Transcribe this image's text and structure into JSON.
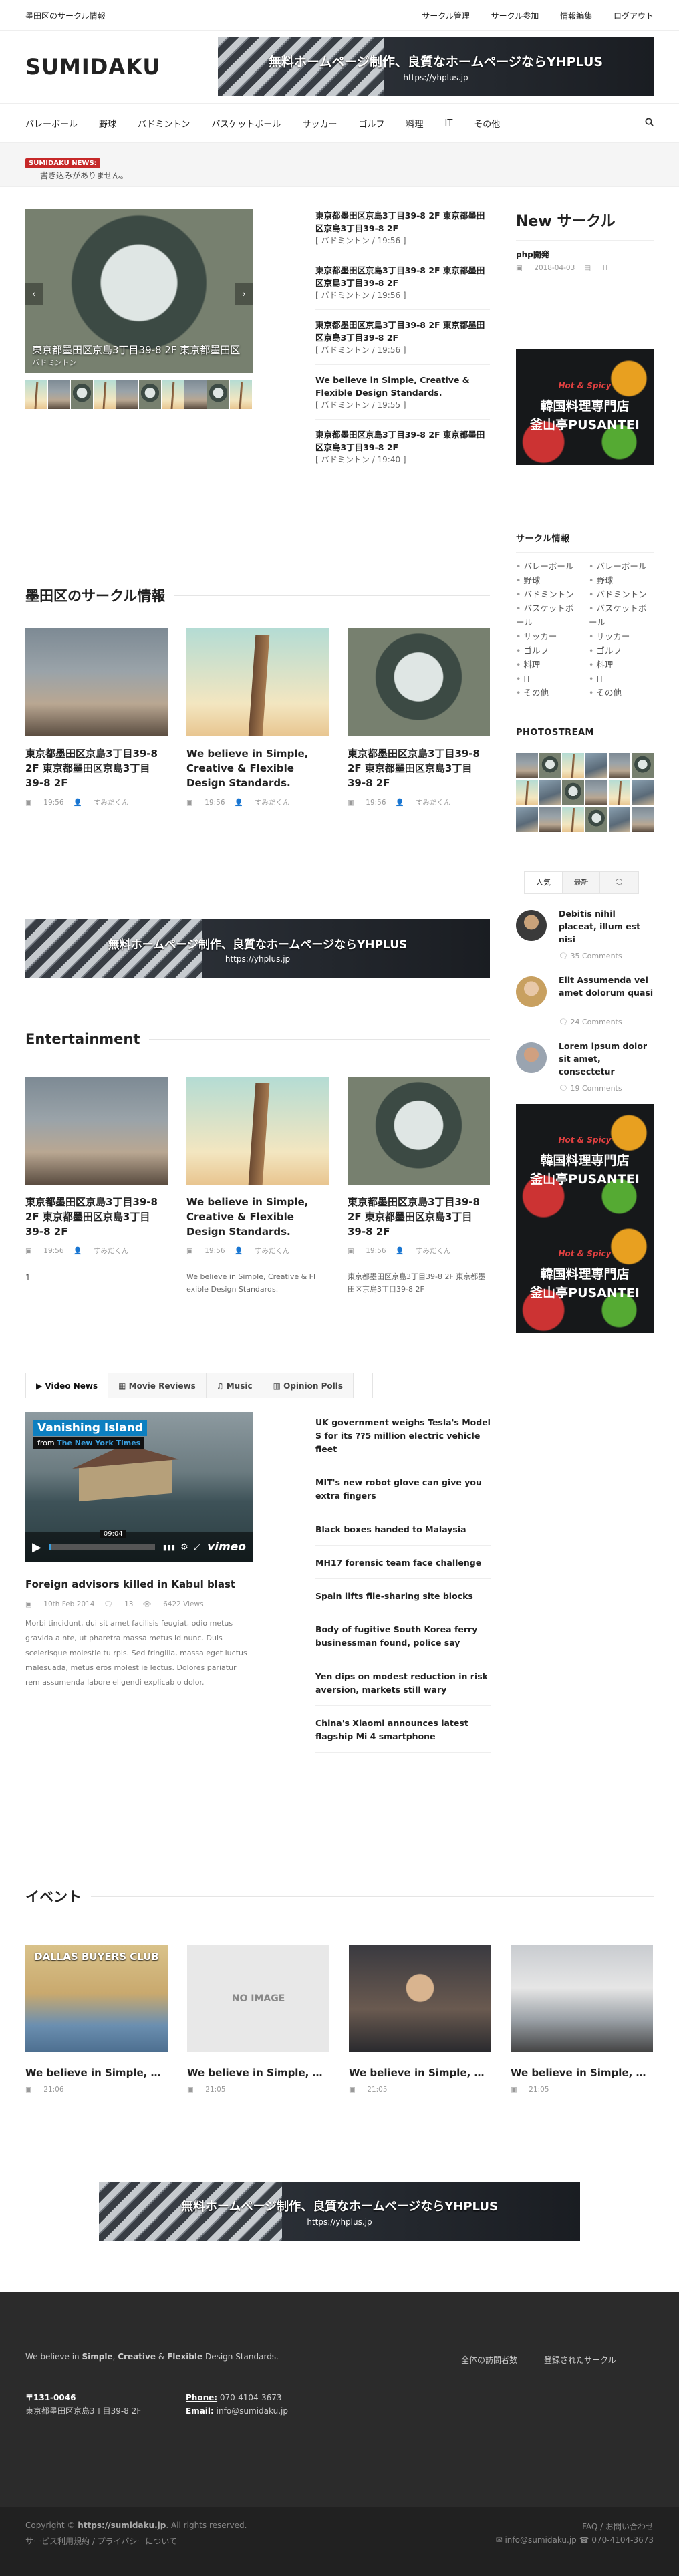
{
  "topbar": {
    "site_name": "墨田区のサークル情報",
    "links": [
      "サークル管理",
      "サークル参加",
      "情報編集",
      "ログアウト"
    ]
  },
  "header": {
    "logo": "SUMIDAKU",
    "banner_text": "無料ホームページ制作、良質なホームページならYHPLUS",
    "banner_url": "https://yhplus.jp"
  },
  "nav": {
    "items": [
      "バレーボール",
      "野球",
      "バドミントン",
      "バスケットボール",
      "サッカー",
      "ゴルフ",
      "料理",
      "IT",
      "その他"
    ],
    "search_icon": "search-icon"
  },
  "news": {
    "tag": "SUMIDAKU NEWS:",
    "message": "書き込みがありません。"
  },
  "slider": {
    "caption": "東京都墨田区京島3丁目39-8 2F 東京都墨田区",
    "category": "バドミントン"
  },
  "featured_list": [
    {
      "title": "東京都墨田区京島3丁目39-8 2F 東京都墨田区京島3丁目39-8 2F",
      "meta": "[ バドミントン / 19:56 ]"
    },
    {
      "title": "東京都墨田区京島3丁目39-8 2F 東京都墨田区京島3丁目39-8 2F",
      "meta": "[ バドミントン / 19:56 ]"
    },
    {
      "title": "東京都墨田区京島3丁目39-8 2F 東京都墨田区京島3丁目39-8 2F",
      "meta": "[ バドミントン / 19:56 ]"
    },
    {
      "title": "We believe in Simple, Creative & Flexible Design Standards.",
      "meta": "[ バドミントン / 19:55 ]"
    },
    {
      "title": "東京都墨田区京島3丁目39-8 2F 東京都墨田区京島3丁目39-8 2F",
      "meta": "[ バドミントン / 19:40 ]"
    }
  ],
  "circle_section": {
    "title": "墨田区のサークル情報",
    "cards": [
      {
        "title": "東京都墨田区京島3丁目39-8 2F 東京都墨田区京島3丁目39-8 2F",
        "time": "19:56",
        "author": "すみだくん"
      },
      {
        "title": "We believe in Simple, Creative & Flexible Design Standards.",
        "time": "19:56",
        "author": "すみだくん"
      },
      {
        "title": "東京都墨田区京島3丁目39-8 2F 東京都墨田区京島3丁目39-8 2F",
        "time": "19:56",
        "author": "すみだくん"
      }
    ]
  },
  "entertainment": {
    "title": "Entertainment",
    "page": "1",
    "cards": [
      {
        "title": "東京都墨田区京島3丁目39-8 2F 東京都墨田区京島3丁目39-8 2F",
        "time": "19:56",
        "author": "すみだくん",
        "excerpt": ""
      },
      {
        "title": "We believe in Simple, Creative & Flexible Design Standards.",
        "time": "19:56",
        "author": "すみだくん",
        "excerpt": "We believe in Simple, Creative & Fl exible Design Standards."
      },
      {
        "title": "東京都墨田区京島3丁目39-8 2F 東京都墨田区京島3丁目39-8 2F",
        "time": "19:56",
        "author": "すみだくん",
        "excerpt": "東京都墨田区京島3丁目39-8 2F 東京都墨田区京島3丁目39-8 2F"
      }
    ]
  },
  "video_tabs": [
    "Video News",
    "Movie Reviews",
    "Music",
    "Opinion Polls"
  ],
  "video": {
    "title": "Vanishing Island",
    "from": "from",
    "source": "The New York Times",
    "duration": "09:04",
    "brand": "vimeo",
    "headline": "Foreign advisors killed in Kabul blast",
    "date": "10th Feb 2014",
    "comments": "13",
    "views": "6422 Views",
    "body": "Morbi tincidunt, dui sit amet facilisis feugiat, odio metus gravida a nte, ut pharetra massa metus id nunc. Duis scelerisque molestie tu rpis. Sed fringilla, massa eget luctus malesuada, metus eros molest ie lectus. Dolores pariatur rem assumenda labore eligendi explicab o dolor."
  },
  "headlines": [
    "UK government weighs Tesla's Model S for its ??5 million electric vehicle fleet",
    "MIT's new robot glove can give you extra fingers",
    "Black boxes handed to Malaysia",
    "MH17 forensic team face challenge",
    "Spain lifts file-sharing site blocks",
    "Body of fugitive South Korea ferry businessman found, police say",
    "Yen dips on modest reduction in risk aversion, markets still wary",
    "China's Xiaomi announces latest flagship Mi 4 smartphone"
  ],
  "events": {
    "title": "イベント",
    "items": [
      {
        "title": "We believe in Simple, Cr...",
        "time": "21:06",
        "img": "DALLAS BUYERS CLUB"
      },
      {
        "title": "We believe in Simple, Cr...",
        "time": "21:05",
        "img": "NO IMAGE"
      },
      {
        "title": "We believe in Simple, Cr...",
        "time": "21:05",
        "img": ""
      },
      {
        "title": "We believe in Simple, Cr...",
        "time": "21:05",
        "img": ""
      }
    ]
  },
  "sidebar": {
    "new_circle": "New サークル",
    "post_title": "php開発",
    "post_date": "2018-04-03",
    "post_cat": "IT",
    "ad": {
      "sub": "Hot & Spicy",
      "line1": "韓国料理専門店",
      "line2": "釜山亭PUSANTEI"
    },
    "circle_info": "サークル情報",
    "cats_left": [
      "バレーボール",
      "野球",
      "バドミントン",
      "バスケットボール",
      "サッカー",
      "ゴルフ",
      "料理",
      "IT",
      "その他"
    ],
    "cats_right": [
      "バレーボール",
      "野球",
      "バドミントン",
      "バスケットボール",
      "サッカー",
      "ゴルフ",
      "料理",
      "IT",
      "その他"
    ],
    "photostream": "PHOTOSTREAM",
    "tabs": [
      "人気",
      "最新",
      "🗨"
    ],
    "popular": [
      {
        "title": "Debitis nihil placeat, illum est nisi",
        "comments": "35 Comments"
      },
      {
        "title": "Elit Assumenda vel amet dolorum quasi",
        "comments": "24 Comments"
      },
      {
        "title": "Lorem ipsum dolor sit amet, consectetur",
        "comments": "19 Comments"
      }
    ]
  },
  "footer": {
    "tagline_pre": "We believe in ",
    "tagline_b1": "Simple",
    "tagline_c1": ", ",
    "tagline_b2": "Creative",
    "tagline_c2": " & ",
    "tagline_b3": "Flexible",
    "tagline_post": " Design Standards.",
    "zip": "〒131-0046",
    "address": "東京都墨田区京島3丁目39-8 2F",
    "phone_label": "Phone:",
    "phone": "070-4104-3673",
    "email_label": "Email:",
    "email": "info@sumidaku.jp",
    "links": [
      "全体の訪問者数",
      "登録されたサークル"
    ]
  },
  "bottom": {
    "copyright_pre": "Copyright © ",
    "copyright_url": "https://sumidaku.jp",
    "copyright_post": ". All rights reserved.",
    "terms": "サービス利用規約 / プライバシーについて",
    "right_links": "FAQ / お問い合わせ",
    "contact": "✉ info@sumidaku.jp    ☎ 070-4104-3673"
  }
}
